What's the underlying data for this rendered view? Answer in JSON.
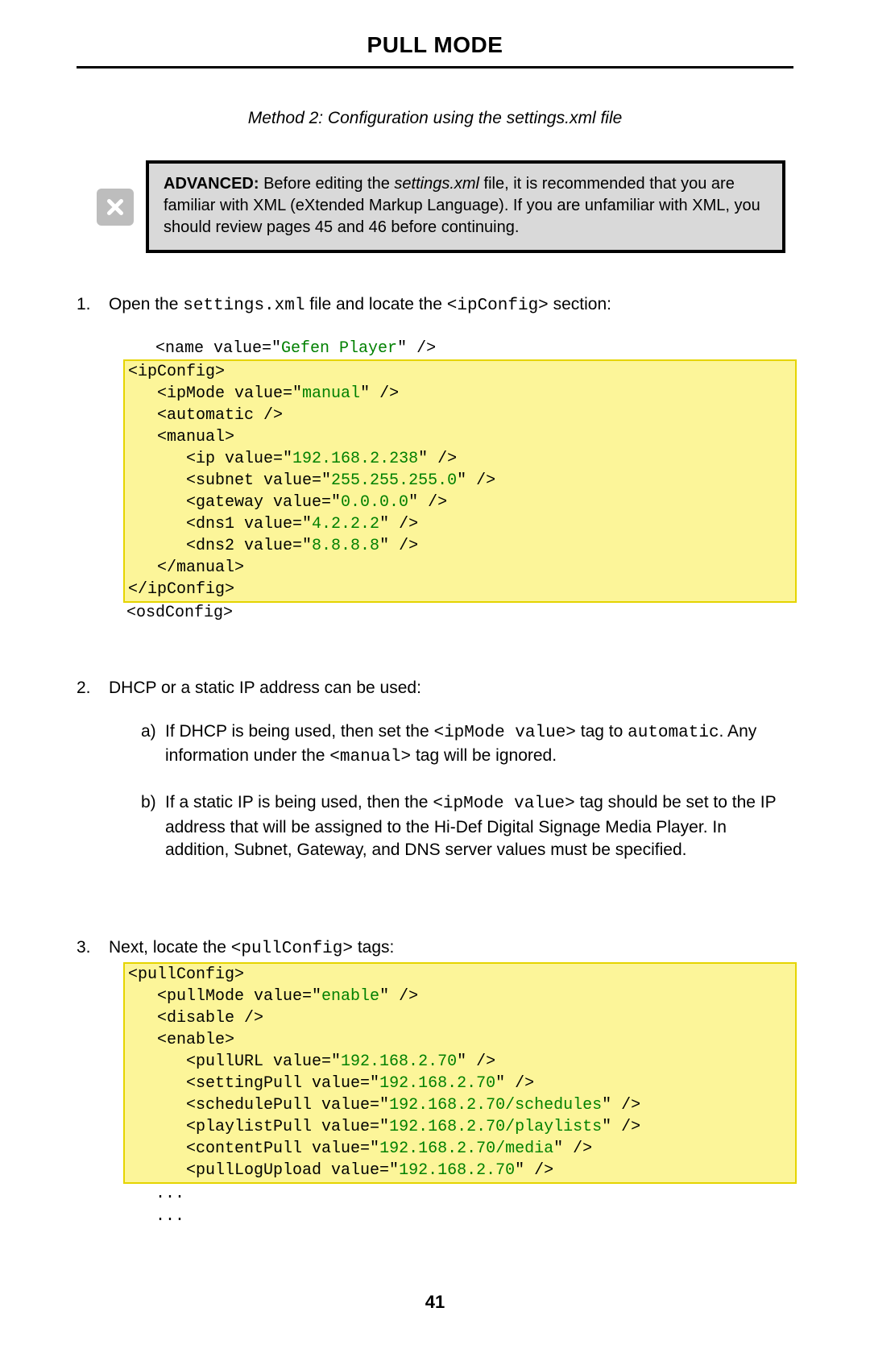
{
  "header": {
    "title": "PULL MODE"
  },
  "subtitle": "Method 2: Configuration using the settings.xml file",
  "advanced": {
    "label": "ADVANCED:",
    "pre": " Before editing the ",
    "file": "settings.xml",
    "post": " file, it is recommended that you are familiar with XML (eXtended Markup Language).  If you are unfamiliar with XML, you should review pages 45 and 46 before continuing."
  },
  "steps": [
    {
      "num": "1.",
      "pre": "Open the ",
      "code1": "settings.xml",
      "mid": " file and locate the ",
      "code2": "<ipConfig>",
      "post": " section:"
    },
    {
      "num": "2.",
      "text": "DHCP or a static IP address can be used:"
    },
    {
      "num": "3.",
      "pre": "Next, locate the ",
      "code1": "<pullConfig>",
      "post": " tags:"
    }
  ],
  "sub": [
    {
      "letter": "a)",
      "pre": "If DHCP is being used, then set the ",
      "code1": "<ipMode value>",
      "mid1": " tag to ",
      "code2": "automatic",
      "mid2": ". Any information under the ",
      "code3": "<manual>",
      "post": " tag will be ignored."
    },
    {
      "letter": "b)",
      "pre": "If a static IP is being used, then the ",
      "code1": "<ipMode value>",
      "post": " tag should be set to the IP address that will be assigned to the Hi-Def Digital Signage Media Player.   In addition, Subnet, Gateway, and DNS server values must be specified."
    }
  ],
  "code1": {
    "l1a": "   <name value=\"",
    "l1b": "Gefen Player",
    "l1c": "\" />",
    "l2": "<ipConfig>",
    "l3a": "   <ipMode value=\"",
    "l3b": "manual",
    "l3c": "\" />",
    "l4": "   <automatic />",
    "l5": "   <manual>",
    "l6a": "      <ip value=\"",
    "l6b": "192.168.2.238",
    "l6c": "\" />",
    "l7a": "      <subnet value=\"",
    "l7b": "255.255.255.0",
    "l7c": "\" />",
    "l8a": "      <gateway value=\"",
    "l8b": "0.0.0.0",
    "l8c": "\" />",
    "l9a": "      <dns1 value=\"",
    "l9b": "4.2.2.2",
    "l9c": "\" />",
    "l10a": "      <dns2 value=\"",
    "l10b": "8.8.8.8",
    "l10c": "\" />",
    "l11": "   </manual>",
    "l12": "</ipConfig>",
    "l13": "<osdConfig>"
  },
  "code2": {
    "l1": "<pullConfig>",
    "l2a": "   <pullMode value=\"",
    "l2b": "enable",
    "l2c": "\" />",
    "l3": "   <disable />",
    "l4": "   <enable>",
    "l5a": "      <pullURL value=\"",
    "l5b": "192.168.2.70",
    "l5c": "\" />",
    "l6a": "      <settingPull value=\"",
    "l6b": "192.168.2.70",
    "l6c": "\" />",
    "l7a": "      <schedulePull value=\"",
    "l7b": "192.168.2.70/schedules",
    "l7c": "\" />",
    "l8a": "      <playlistPull value=\"",
    "l8b": "192.168.2.70/playlists",
    "l8c": "\" />",
    "l9a": "      <contentPull value=\"",
    "l9b": "192.168.2.70/media",
    "l9c": "\" />",
    "l10a": "      <pullLogUpload value=\"",
    "l10b": "192.168.2.70",
    "l10c": "\" />",
    "l11": "   ...",
    "l12": "   ..."
  },
  "pageNumber": "41"
}
